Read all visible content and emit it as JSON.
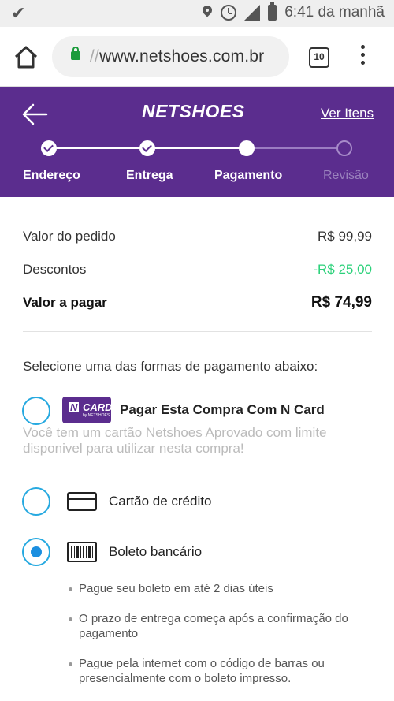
{
  "status_bar": {
    "time": "6:41 da manhã"
  },
  "browser": {
    "url_prefix": "//",
    "url": "www.netshoes.com.br",
    "tab_count": "10"
  },
  "header": {
    "logo": "NETSHOES",
    "ver_itens": "Ver Itens",
    "steps": [
      {
        "label": "Endereço",
        "state": "done"
      },
      {
        "label": "Entrega",
        "state": "done"
      },
      {
        "label": "Pagamento",
        "state": "current"
      },
      {
        "label": "Revisão",
        "state": "todo"
      }
    ]
  },
  "summary": {
    "order_label": "Valor do pedido",
    "order_value": "R$ 99,99",
    "discount_label": "Descontos",
    "discount_value": "-R$ 25,00",
    "total_label": "Valor a pagar",
    "total_value": "R$ 74,99"
  },
  "payment": {
    "title": "Selecione uma das formas de pagamento abaixo:",
    "ncard": {
      "badge_n": "N",
      "badge_card": "CARD",
      "badge_by": "by NETSHOES",
      "label": "Pagar Esta Compra Com N Card",
      "description": "Você tem um cartão Netshoes Aprovado com limite disponivel para utilizar nesta compra!"
    },
    "credit_card": {
      "label": "Cartão de crédito"
    },
    "boleto": {
      "label": "Boleto bancário",
      "selected": true,
      "bullets": [
        "Pague seu boleto em até 2 dias úteis",
        "O prazo de entrega começa após a confirmação do pagamento",
        "Pague pela internet com o código de barras ou presencialmente com o boleto impresso."
      ]
    }
  },
  "colors": {
    "brand_purple": "#5b2d8e",
    "radio_blue": "#26a9e0",
    "discount_green": "#2bd17a"
  }
}
